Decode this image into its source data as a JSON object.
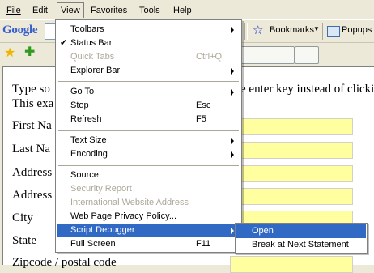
{
  "menubar": {
    "items": [
      {
        "label": "File"
      },
      {
        "label": "Edit"
      },
      {
        "label": "View"
      },
      {
        "label": "Favorites"
      },
      {
        "label": "Tools"
      },
      {
        "label": "Help"
      }
    ]
  },
  "google_toolbar": {
    "logo": "Google",
    "bookmarks_label": "Bookmarks",
    "popups_label": "Popups"
  },
  "page": {
    "intro_line1": "Type so",
    "intro_line1_right": "e enter key instead of clickin",
    "intro_line2": "This exa",
    "labels": [
      "First Na",
      "Last Na",
      "Address",
      "Address",
      "City",
      "State",
      "Zipcode / postal code"
    ]
  },
  "view_menu": {
    "items": [
      {
        "label": "Toolbars",
        "submenu": true
      },
      {
        "label": "Status Bar",
        "checked": true
      },
      {
        "label": "Quick Tabs",
        "shortcut": "Ctrl+Q",
        "disabled": true
      },
      {
        "label": "Explorer Bar",
        "submenu": true
      },
      {
        "label": "Go To",
        "submenu": true
      },
      {
        "label": "Stop",
        "shortcut": "Esc"
      },
      {
        "label": "Refresh",
        "shortcut": "F5"
      },
      {
        "label": "Text Size",
        "submenu": true
      },
      {
        "label": "Encoding",
        "submenu": true
      },
      {
        "label": "Source"
      },
      {
        "label": "Security Report",
        "disabled": true
      },
      {
        "label": "International Website Address",
        "disabled": true
      },
      {
        "label": "Web Page Privacy Policy..."
      },
      {
        "label": "Script Debugger",
        "submenu": true,
        "highlighted": true
      },
      {
        "label": "Full Screen",
        "shortcut": "F11"
      }
    ]
  },
  "script_debugger_submenu": {
    "items": [
      {
        "label": "Open",
        "highlighted": true
      },
      {
        "label": "Break at Next Statement"
      }
    ]
  }
}
